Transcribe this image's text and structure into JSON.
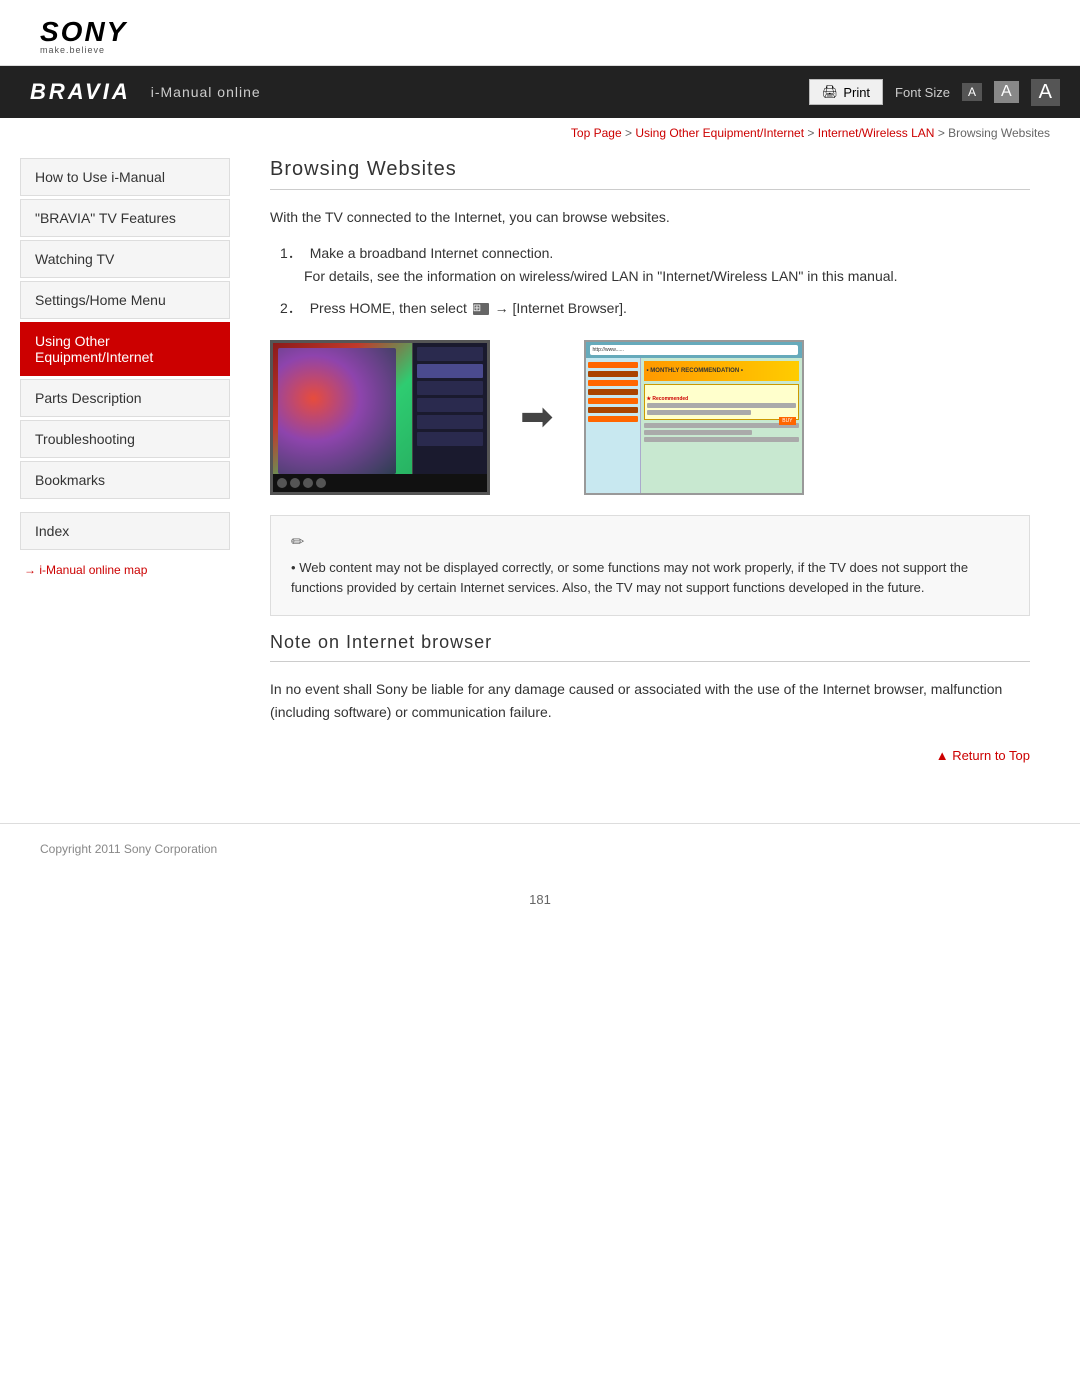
{
  "header": {
    "sony_text": "SONY",
    "sony_tagline": "make.believe",
    "bravia_logo": "BRAVIA",
    "nav_title": "i-Manual online",
    "print_label": "Print",
    "font_size_label": "Font Size",
    "font_a_small": "A",
    "font_a_medium": "A",
    "font_a_large": "A"
  },
  "breadcrumb": {
    "top_page": "Top Page",
    "sep1": " > ",
    "using_equipment": "Using Other Equipment/Internet",
    "sep2": " > ",
    "internet_lan": "Internet/Wireless LAN",
    "sep3": " > ",
    "current": "Browsing Websites"
  },
  "sidebar": {
    "items": [
      {
        "id": "how-to-use",
        "label": "How to Use i-Manual",
        "active": false
      },
      {
        "id": "bravia-features",
        "label": "\"BRAVIA\" TV Features",
        "active": false
      },
      {
        "id": "watching-tv",
        "label": "Watching TV",
        "active": false
      },
      {
        "id": "settings-home",
        "label": "Settings/Home Menu",
        "active": false
      },
      {
        "id": "using-other",
        "label": "Using Other Equipment/Internet",
        "active": true
      },
      {
        "id": "parts-description",
        "label": "Parts Description",
        "active": false
      },
      {
        "id": "troubleshooting",
        "label": "Troubleshooting",
        "active": false
      },
      {
        "id": "bookmarks",
        "label": "Bookmarks",
        "active": false
      }
    ],
    "index_label": "Index",
    "map_link_arrow": "→",
    "map_link_label": "i-Manual online map"
  },
  "content": {
    "main_title": "Browsing Websites",
    "intro_text": "With the TV connected to the Internet, you can browse websites.",
    "step1_number": "1．",
    "step1_text": "Make a broadband Internet connection.",
    "step1_detail": "For details, see the information on wireless/wired LAN in \"Internet/Wireless LAN\" in this manual.",
    "step2_number": "2．",
    "step2_text": "Press HOME, then select ",
    "step2_text2": " → [Internet Browser].",
    "note_icon": "✏",
    "note_bullet": "•",
    "note_text": "Web content may not be displayed correctly, or some functions may not work properly, if the TV does not support the functions provided by certain Internet services. Also, the TV may not support functions developed in the future.",
    "browser_url_text": "http://www......",
    "section2_title": "Note on Internet browser",
    "section2_text": "In no event shall Sony be liable for any damage caused or associated with the use of the Internet browser, malfunction (including software) or communication failure.",
    "return_to_top_arrow": "▲",
    "return_to_top_label": "Return to Top",
    "browser_banner_text": "• MONTHLY RECOMMENDATION •",
    "browser_orange_text": "BUY"
  },
  "footer": {
    "copyright": "Copyright 2011 Sony Corporation"
  },
  "page": {
    "number": "181"
  }
}
